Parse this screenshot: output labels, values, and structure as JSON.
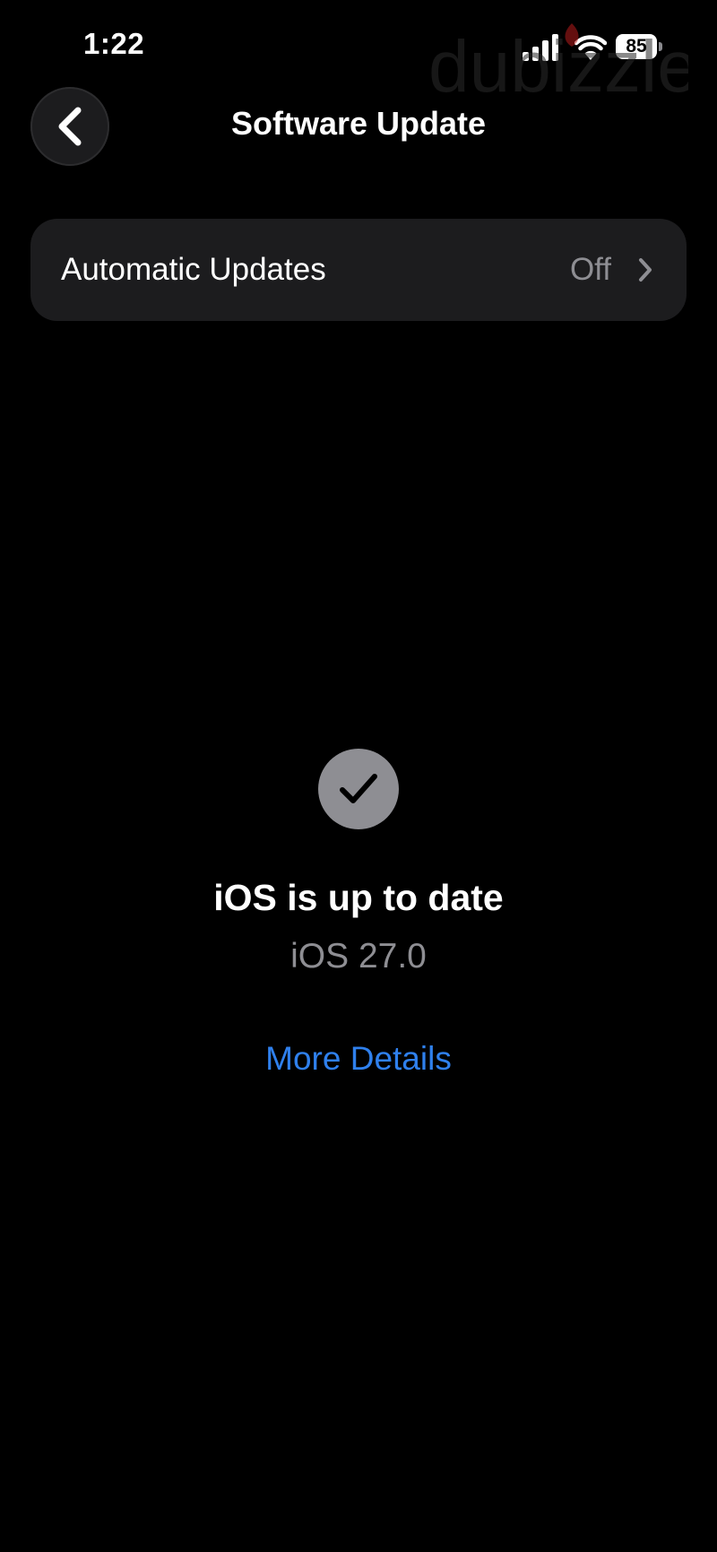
{
  "status_bar": {
    "time": "1:22",
    "battery_level": "85"
  },
  "watermark": {
    "text": "dubizzle"
  },
  "nav": {
    "title": "Software Update",
    "back_icon": "chevron-left-icon"
  },
  "settings": {
    "automatic_updates": {
      "label": "Automatic Updates",
      "value": "Off"
    }
  },
  "status": {
    "icon": "checkmark-icon",
    "title": "iOS is up to date",
    "version": "iOS 27.0",
    "link": "More Details"
  },
  "colors": {
    "background": "#000000",
    "cell": "#1c1c1e",
    "secondary_text": "#8e8e93",
    "link": "#2f80ed"
  }
}
